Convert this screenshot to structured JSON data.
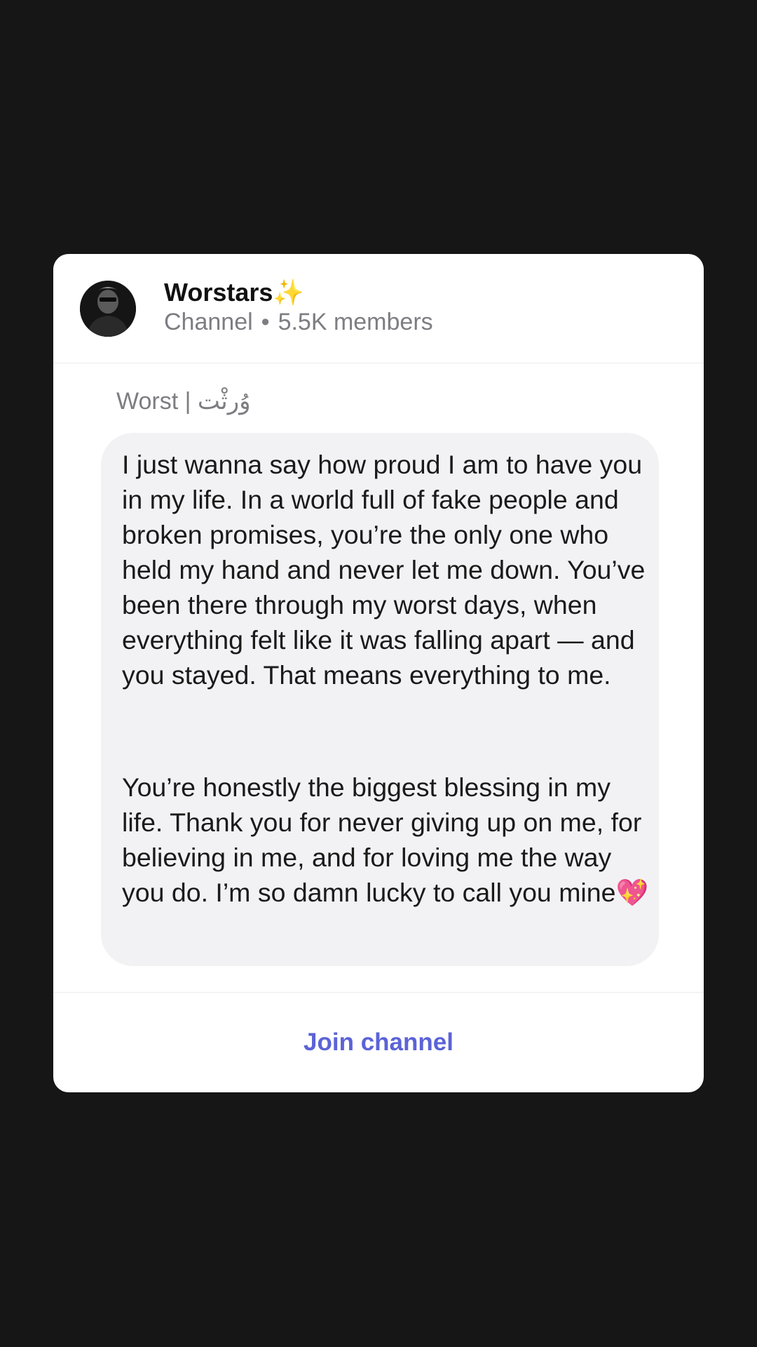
{
  "channel": {
    "name": "Worstars",
    "name_emoji": "✨",
    "type": "Channel",
    "separator": "•",
    "members": "5.5K members"
  },
  "post": {
    "author": "Worst | وُرثْت",
    "paragraph_1": "I just wanna say how proud I am to have you in my life. In a world full of fake people and broken promises, you’re the only one who held my hand and never let me down. You’ve been there through my worst days, when everything felt like it was falling apart — and you stayed. That means everything to me.",
    "paragraph_2": "You’re honestly the biggest blessing in my life. Thank you for never giving up on me, for believing in me, and for loving me the way you do. I’m so damn lucky to call you mine💖"
  },
  "actions": {
    "join_label": "Join channel"
  },
  "colors": {
    "accent": "#5b63d6",
    "background": "#161616",
    "card": "#ffffff",
    "bubble": "#f2f2f4",
    "muted_text": "#7d7d82"
  },
  "icons": {
    "avatar": "channel-avatar-photo"
  }
}
